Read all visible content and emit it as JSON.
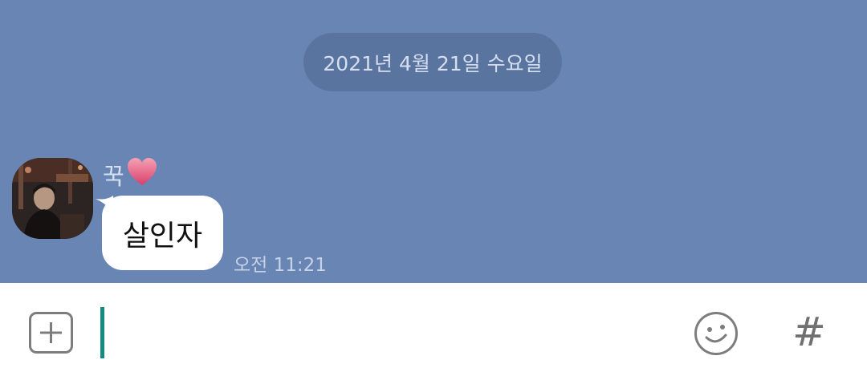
{
  "date_divider": "2021년 4월 21일 수요일",
  "message": {
    "sender": "꾹",
    "sender_emoji": "heart-icon",
    "text": "살인자",
    "time": "오전 11:21"
  },
  "input": {
    "placeholder": "",
    "value": "",
    "attach_icon": "plus-square-icon",
    "emoji_icon": "smiley-icon",
    "hashtag_label": "#"
  },
  "colors": {
    "chat_background": "#6885b4",
    "date_pill": "#5a74a0",
    "cursor": "#148b7e",
    "heart": "#e8607f"
  }
}
